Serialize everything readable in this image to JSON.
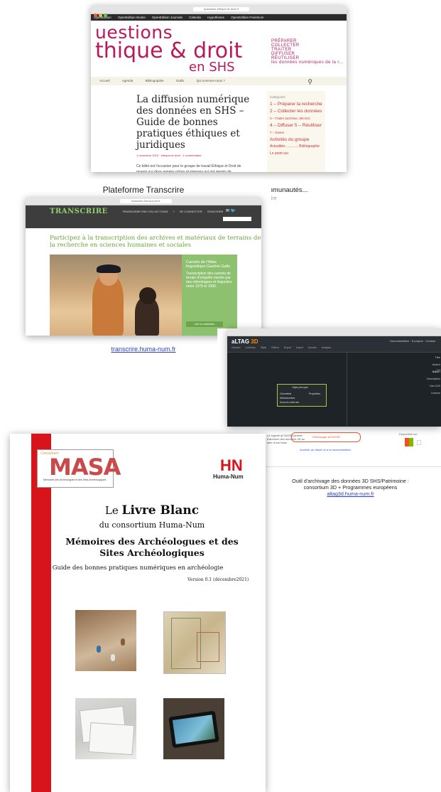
{
  "card1": {
    "url": "questions-ethique-et-droit.fr",
    "navbar": [
      "OpenEdition",
      "OpenEdition Books",
      "OpenEdition Journals",
      "Calenda",
      "Hypotheses",
      "OpenEdition Freemium"
    ],
    "site_title_line1": "uestions",
    "site_title_line2": "thique & droit",
    "site_title_line3": "en SHS",
    "right_lines": [
      "PRÉPARER",
      "COLLECTER",
      "TRAITER",
      "DIFFUSER",
      "RÉUTILISER",
      "les données numériques de la r..."
    ],
    "menu": [
      "Accueil",
      "Agenda",
      "Bibliographie",
      "Outils",
      "Qui sommes-nous ?"
    ],
    "article_title": "La diffusion numérique des données en SHS – Guide de bonnes pratiques éthiques et juridiques",
    "article_meta": "1 novembre 2019 · ethique-et-droit · 1 commentaire",
    "article_body": "Ce billet est l'occasion pour le groupe de travail Éthique et Droit de revenir sur deux années riches et intenses qui ont permis de",
    "sidebar_heading": "Catégories",
    "sidebar_items": [
      "1 – Préparer la recherche",
      "2 – Collecter les données",
      "3 – Traiter (archiver, décrire)",
      "4 – Diffuser 5 – Réutiliser",
      "7 – Divers",
      "Activités du groupe",
      "Actualités ............ Bibliographie",
      "Le point sur"
    ],
    "communautes": "mmunautés...",
    "cut_text": "...ire"
  },
  "card2": {
    "caption": "Plateforme Transcrire",
    "url": "transcrire.huma-num.fr",
    "logo": "TRANSCRIRE",
    "nav": [
      "TRANSCRIRE PAR COLLECTIONS",
      "?",
      "SE CONNECTER",
      "S'INSCRIRE"
    ],
    "social": "✉ 🐦",
    "headline": "Participez à la transcription des archives et matériaux de terrains de la recherche en sciences humaines et sociales",
    "green_title": "Carnets de l'Atlas linguistique Gaulois Gallo",
    "green_text": "Transcription des carnets de terrain d'enquête menée par des ethnologues et linguistes entre 1970 et 1990.",
    "green_button": "Voir la collection",
    "link": "transcrire.huma-num.fr"
  },
  "card3": {
    "logo": "aLTAG",
    "logo_suffix": "3D",
    "tools": [
      "Camera",
      "Lumières",
      "Objet",
      "Édition",
      "Export",
      "Import",
      "Annoter",
      "Analyser"
    ],
    "right_menu": [
      "Documentation",
      "À propos",
      "Contact"
    ],
    "node_title": "Objet principal",
    "node_items": [
      "Géométrie",
      "Métadonnées",
      "Sources externes"
    ],
    "node_side": "Propriétés",
    "form_lines": [
      "Titre",
      "Auteur",
      "اللغة",
      "Description",
      "Lien DOI",
      "Licence"
    ],
    "blurb": "Le logiciel aLTAG3D permet d'archiver des données 3D au sein d'une base.",
    "button": "Télécharger aLTAG3D",
    "download_link": "Accéder au dépôt ou à la documentation",
    "download_label": "Disponible sur",
    "caption_line1": "Outil d'archivage des données 3D SHS/Patrimoine :",
    "caption_line2": "consortium 3D + Programmes européens",
    "caption_link": "altag3d.huma-num.fr"
  },
  "card4": {
    "masa_corner": "Consortium",
    "masa_logo": "MASA",
    "masa_sub": "Mémoires des Archéologues et des Sites Archéologiques",
    "huma_logo": "HN",
    "huma_text": "Huma-Num",
    "title_prefix": "Le ",
    "title_bold": "Livre Blanc",
    "subtitle": "du consortium Huma-Num",
    "main_title": "Mémoires des Archéologues et des Sites Archéologiques",
    "guide": "Guide des bonnes pratiques numériques en archéologie",
    "version": "Version 0.1 (décembre2021)"
  },
  "colors": {
    "accent": "#b8195a",
    "transcrire_green": "#8dc06f",
    "huma_red": "#d7131c",
    "link": "#2a3fcc"
  }
}
